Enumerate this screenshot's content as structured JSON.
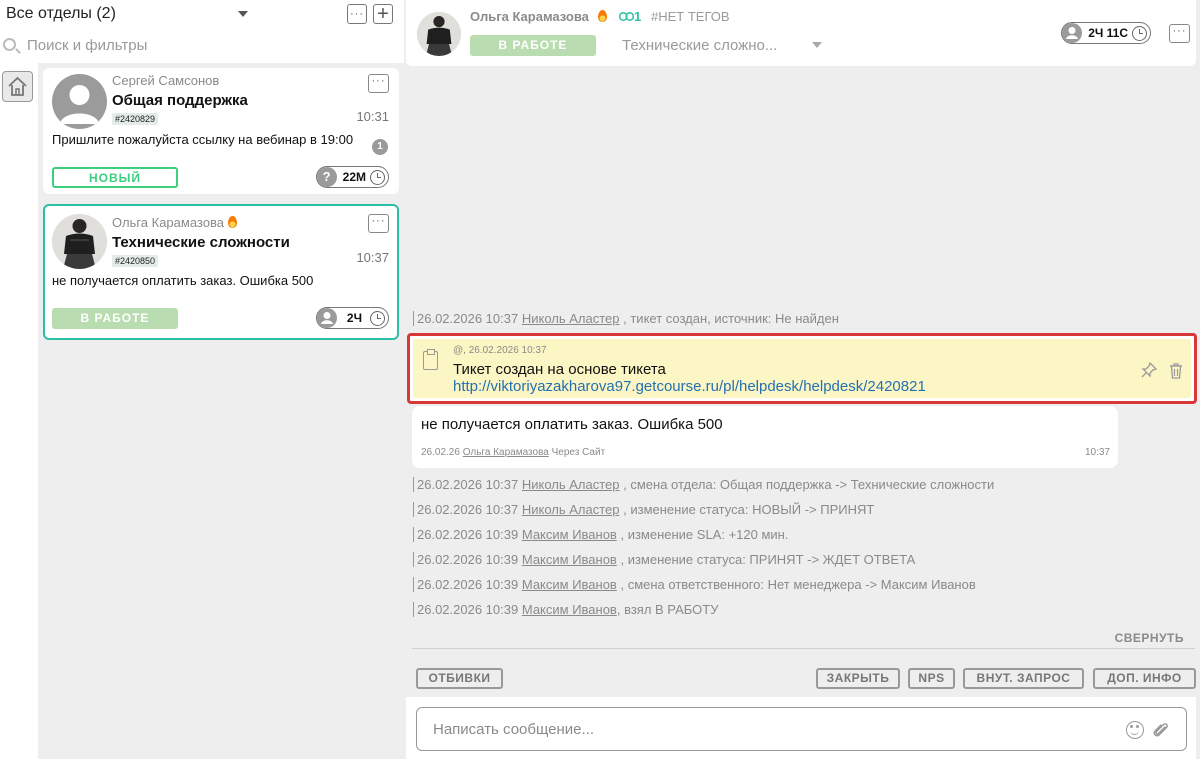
{
  "left": {
    "dept_title": "Все отделы (2)",
    "add_symbol": "+",
    "dots_symbol": "···",
    "search_placeholder": "Поиск и фильтры",
    "tickets": [
      {
        "author": "Сергей Самсонов",
        "subject": "Общая поддержка",
        "id": "#2420829",
        "time": "10:31",
        "text": "Пришлите пожалуйста ссылку на вебинар в 19:00",
        "unread": "1",
        "status": "НОВЫЙ",
        "sla_icon": "?",
        "sla": "22М",
        "hot": false
      },
      {
        "author": "Ольга Карамазова",
        "subject": "Технические сложности",
        "id": "#2420850",
        "time": "10:37",
        "text": "не получается оплатить заказ. Ошибка 500",
        "status": "В РАБОТЕ",
        "sla": "2Ч",
        "hot": true
      }
    ]
  },
  "header": {
    "name": "Ольга Карамазова",
    "link_count": "1",
    "tags": "#НЕТ ТЕГОВ",
    "status": "В РАБОТЕ",
    "department": "Технические сложно...",
    "sla": "2Ч 11С"
  },
  "events_top": [
    {
      "date": "26.02.2026 10:37",
      "user": "Николь Аластер",
      "text": ", тикет создан, источник: Не найден"
    }
  ],
  "note": {
    "date": "@, 26.02.2026 10:37",
    "title": "Тикет создан на основе тикета",
    "link": "http://viktoriyazakharova97.getcourse.ru/pl/helpdesk/helpdesk/2420821"
  },
  "message": {
    "text": "не получается оплатить заказ. Ошибка 500",
    "date": "26.02.26",
    "author": "Ольга Карамазова",
    "via": "Через Сайт",
    "time": "10:37"
  },
  "events": [
    {
      "date": "26.02.2026 10:37",
      "user": "Николь Аластер",
      "text": ", смена отдела: Общая поддержка -> Технические сложности"
    },
    {
      "date": "26.02.2026 10:37",
      "user": "Николь Аластер",
      "text": ", изменение статуса: НОВЫЙ -> ПРИНЯТ"
    },
    {
      "date": "26.02.2026 10:39",
      "user": "Максим Иванов",
      "text": ", изменение SLA: +120 мин."
    },
    {
      "date": "26.02.2026 10:39",
      "user": "Максим Иванов",
      "text": ", изменение статуса: ПРИНЯТ -> ЖДЕТ ОТВЕТА"
    },
    {
      "date": "26.02.2026 10:39",
      "user": "Максим Иванов",
      "text": ", смена ответственного: Нет менеджера -> Максим Иванов"
    },
    {
      "date": "26.02.2026 10:39",
      "user": "Максим Иванов",
      "text": ", взял В РАБОТУ"
    }
  ],
  "collapse_label": "СВЕРНУТЬ",
  "actions": {
    "templates": "ОТБИВКИ",
    "close": "ЗАКРЫТЬ",
    "nps": "NPS",
    "internal": "ВНУТ. ЗАПРОС",
    "extra": "ДОП. ИНФО"
  },
  "composer": {
    "placeholder": "Написать сообщение..."
  },
  "colors": {
    "accent": "#2bbfa4",
    "new_status": "#3ad07f",
    "work_status": "#b9ddb0",
    "note_bg": "#fcf6c4",
    "highlight": "#d93838",
    "link": "#2470b3"
  }
}
